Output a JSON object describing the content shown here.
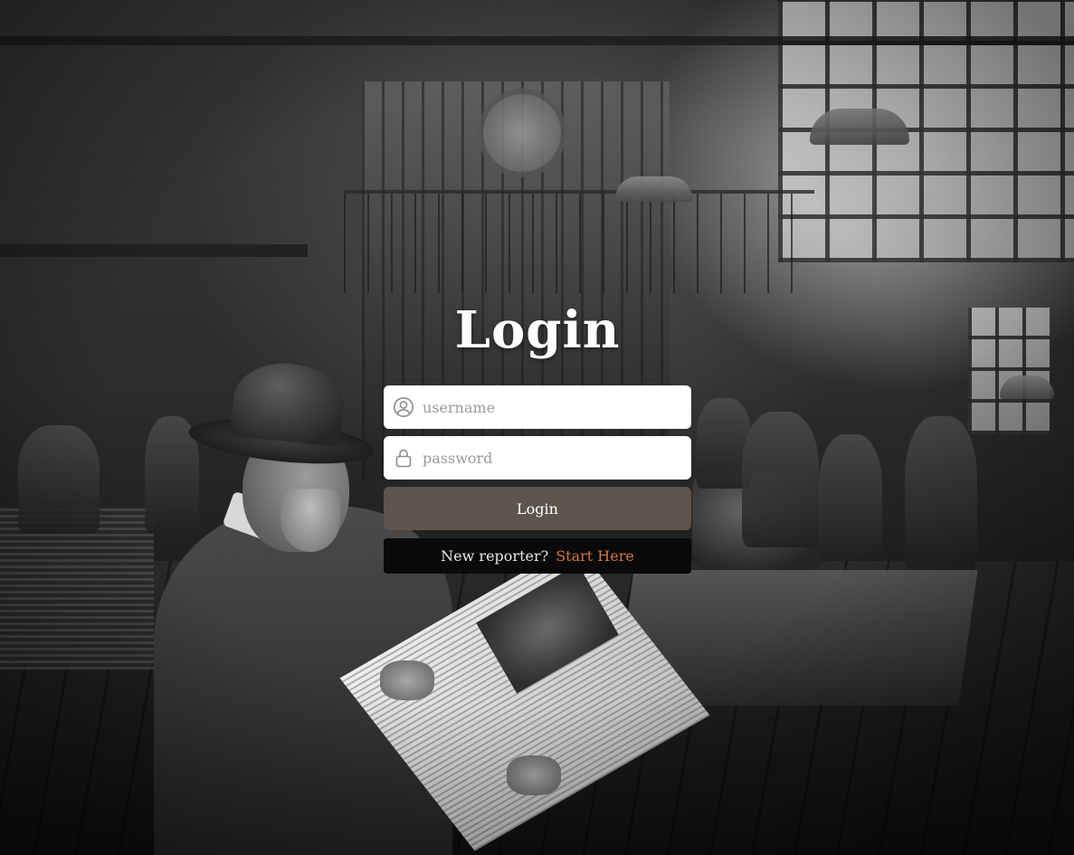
{
  "login": {
    "title": "Login",
    "username": {
      "placeholder": "username",
      "value": "",
      "icon": "user-circle-icon"
    },
    "password": {
      "placeholder": "password",
      "value": "",
      "icon": "lock-icon"
    },
    "submit_label": "Login",
    "signup_prompt": "New reporter?",
    "signup_link": "Start Here"
  },
  "colors": {
    "button_bg": "#5c554e",
    "link": "#d2793e",
    "signup_bg": "#0a0a0a",
    "input_bg": "#ffffff"
  }
}
